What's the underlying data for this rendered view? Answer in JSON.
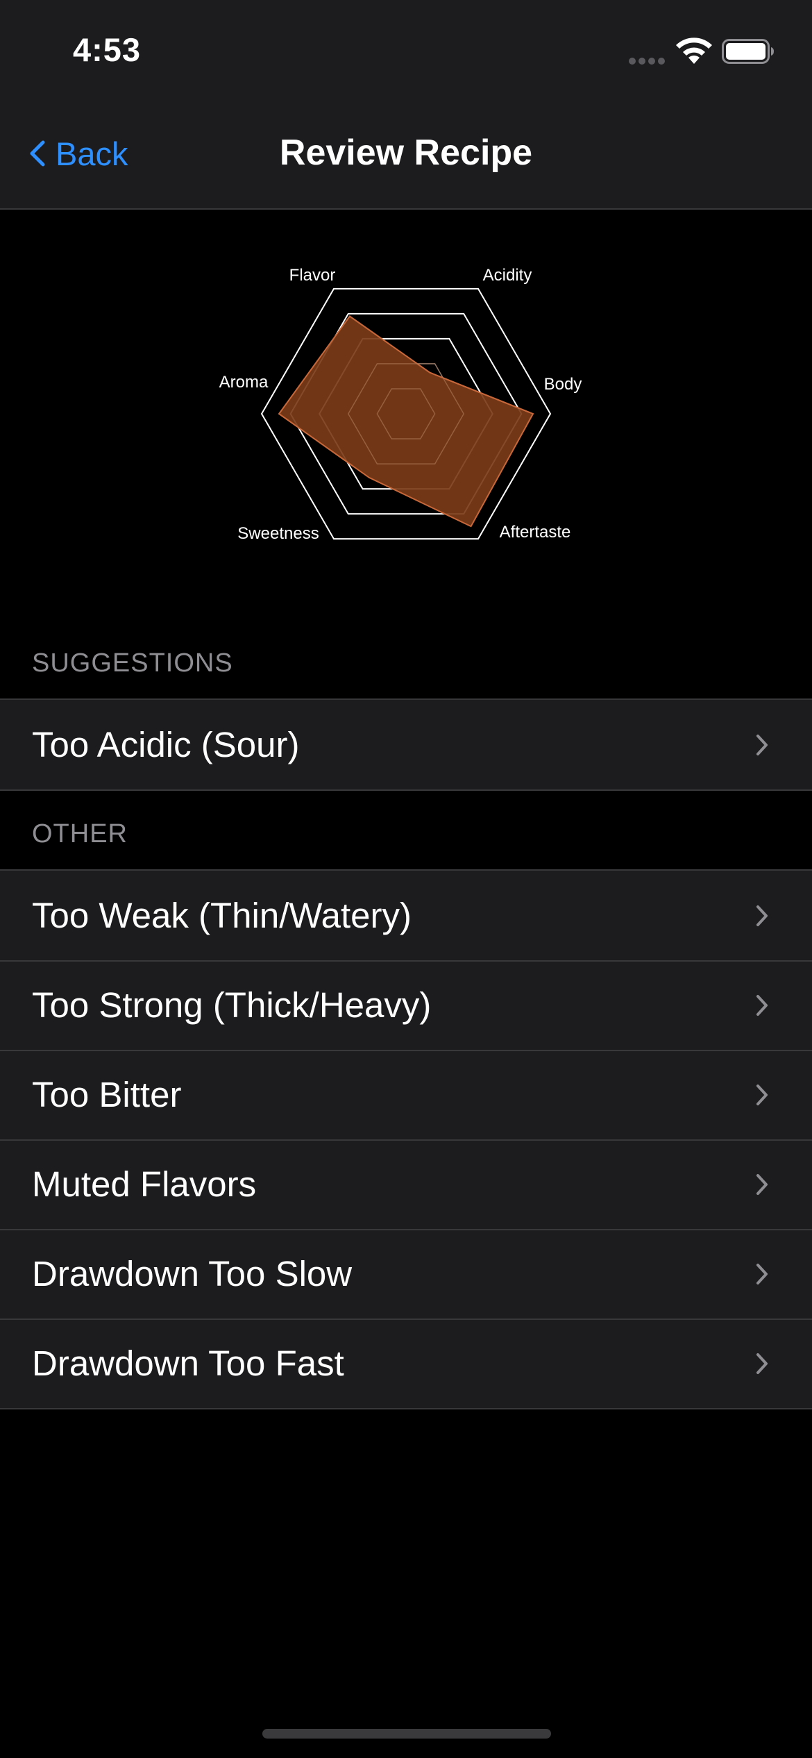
{
  "status_bar": {
    "time": "4:53",
    "icons": [
      "cellular-signal-icon",
      "wifi-icon",
      "battery-icon"
    ]
  },
  "nav": {
    "back_label": "Back",
    "title": "Review Recipe"
  },
  "colors": {
    "accent": "#2e8fff",
    "chart_fill": "#7a3b17",
    "chart_stroke": "#c8683a",
    "background": "#000000",
    "cell_background": "#1c1c1e"
  },
  "chart_data": {
    "type": "radar",
    "axes": [
      "Flavor",
      "Acidity",
      "Body",
      "Aftertaste",
      "Sweetness",
      "Aroma"
    ],
    "values": [
      0.78,
      0.33,
      0.88,
      0.9,
      0.51,
      0.88
    ],
    "max": 1,
    "rings": [
      0.2,
      0.4,
      0.6,
      0.8,
      1.0
    ]
  },
  "suggestions": {
    "header": "SUGGESTIONS",
    "items": [
      {
        "label": "Too Acidic (Sour)"
      }
    ]
  },
  "other": {
    "header": "OTHER",
    "items": [
      {
        "label": "Too Weak (Thin/Watery)"
      },
      {
        "label": "Too Strong (Thick/Heavy)"
      },
      {
        "label": "Too Bitter"
      },
      {
        "label": "Muted Flavors"
      },
      {
        "label": "Drawdown Too Slow"
      },
      {
        "label": "Drawdown Too Fast"
      }
    ]
  }
}
